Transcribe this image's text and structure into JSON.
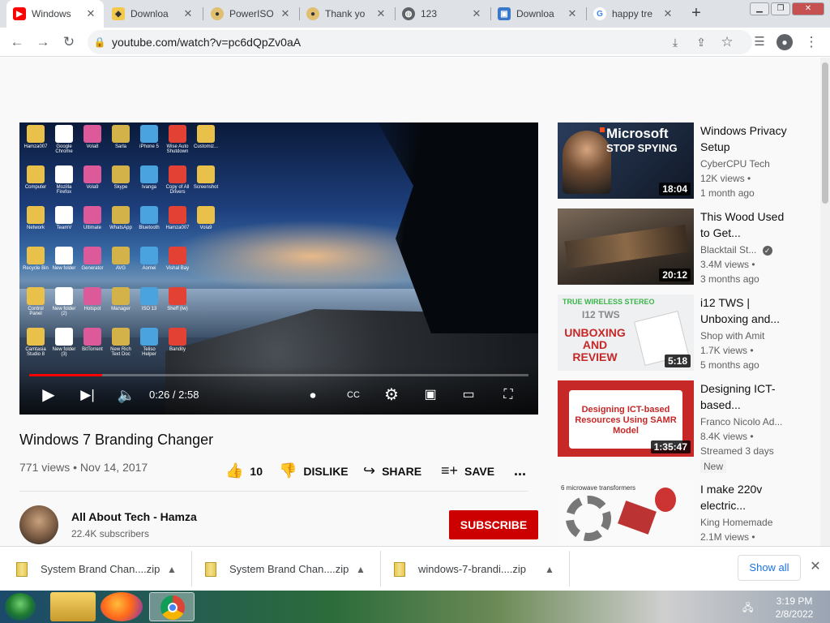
{
  "browser": {
    "tabs": [
      {
        "title": "Windows",
        "active": true,
        "favicon": "youtube-icon"
      },
      {
        "title": "Downloa",
        "active": false,
        "favicon": "download-site-icon"
      },
      {
        "title": "PowerISO",
        "active": false,
        "favicon": "poweriso-icon"
      },
      {
        "title": "Thank yo",
        "active": false,
        "favicon": "poweriso-icon"
      },
      {
        "title": "123",
        "active": false,
        "favicon": "globe-icon"
      },
      {
        "title": "Downloa",
        "active": false,
        "favicon": "download-site-icon"
      },
      {
        "title": "happy tre",
        "active": false,
        "favicon": "google-icon"
      }
    ],
    "url": "youtube.com/watch?v=pc6dQpZv0aA"
  },
  "video": {
    "time": "0:26 / 2:58",
    "progress_fraction": 0.146,
    "title": "Windows 7 Branding Changer",
    "views_date": "771 views • Nov 14, 2017",
    "actions": {
      "like_count": "10",
      "dislike": "DISLIKE",
      "share": "SHARE",
      "save": "SAVE",
      "more": "..."
    },
    "channel": {
      "name": "All About Tech - Hamza",
      "subscribers": "22.4K subscribers",
      "subscribe_label": "SUBSCRIBE"
    },
    "desktop_icons": [
      "Hamza007",
      "Google Chrome",
      "Vola8",
      "Sarla",
      "iPhone 5",
      "Wise Auto Shutdown",
      "Customiz...",
      "Computer",
      "Mozilla Firefox",
      "Vola9",
      "Skype",
      "Ivanga",
      "Copy of All Drivers",
      "Screenshot",
      "Network",
      "TeamV",
      "Ultimate",
      "WhatsApp",
      "Bluetooth",
      "Hamza007",
      "Vola9",
      "Recycle Bin",
      "New folder",
      "Generator",
      "AVG",
      "Aomei",
      "Vishal Bay",
      "",
      "Control Panel",
      "New folder (2)",
      "Hotspot",
      "Manager",
      "ISO 13",
      "Sheff (Iw)",
      "",
      "Camtasia Studio 8",
      "New folder (3)",
      "BitTorrent",
      "New Rich Text Doc",
      "Teliso Helper",
      "Bandity"
    ]
  },
  "recommendations": [
    {
      "title": "Windows Privacy Setup",
      "channel": "CyberCPU Tech",
      "views": "12K views •",
      "age": "1 month ago",
      "duration": "18:04",
      "verified": false,
      "badge": ""
    },
    {
      "title": "This Wood Used to Get...",
      "channel": "Blacktail St...",
      "views": "3.4M views •",
      "age": "3 months ago",
      "duration": "20:12",
      "verified": true,
      "badge": ""
    },
    {
      "title": "i12 TWS | Unboxing and...",
      "channel": "Shop with Amit",
      "views": "1.7K views •",
      "age": "5 months ago",
      "duration": "5:18",
      "verified": false,
      "badge": ""
    },
    {
      "title": "Designing ICT-based...",
      "channel": "Franco Nicolo Ad...",
      "views": "8.4K views •",
      "age": "Streamed 3 days",
      "duration": "1:35:47",
      "verified": false,
      "badge": "New"
    },
    {
      "title": "I make 220v electric...",
      "channel": "King Homemade",
      "views": "2.1M views •",
      "age": "",
      "duration": "",
      "verified": false,
      "badge": ""
    }
  ],
  "thumb_text": {
    "t1a": "Microsoft",
    "t1b": "STOP SPYING",
    "t3a": "TRUE WIRELESS STEREO",
    "t3b": "I12 TWS",
    "t3c": "UNBOXING AND REVIEW",
    "t4a": "Designing ICT-based Resources Using SAMR Model",
    "t5a": "6 microwave transformers"
  },
  "downloads": [
    {
      "name": "System Brand Chan....zip"
    },
    {
      "name": "System Brand Chan....zip"
    },
    {
      "name": "windows-7-brandi....zip"
    }
  ],
  "shelf": {
    "show_all": "Show all"
  },
  "taskbar": {
    "time": "3:19 PM",
    "date": "2/8/2022"
  },
  "colors": {
    "accent": "#cc0000",
    "progress": "#ff0000",
    "link": "#1a73e8"
  }
}
